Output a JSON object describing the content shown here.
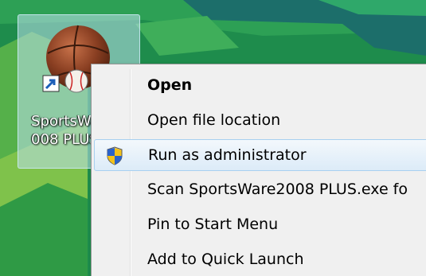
{
  "desktop": {
    "icon_label": "SportsWare 2008 PLUS"
  },
  "context_menu": {
    "items": [
      {
        "label": "Open",
        "bold": true
      },
      {
        "label": "Open file location"
      },
      {
        "label": "Run as administrator",
        "icon": "uac-shield-icon",
        "highlighted": true
      },
      {
        "label": "Scan SportsWare2008 PLUS.exe fo"
      },
      {
        "label": "Pin to Start Menu"
      },
      {
        "label": "Add to Quick Launch"
      }
    ]
  },
  "colors": {
    "desktop_green": "#1f8f4f",
    "menu_background": "#f0f0f0",
    "highlight_border": "#a8d0f0"
  }
}
